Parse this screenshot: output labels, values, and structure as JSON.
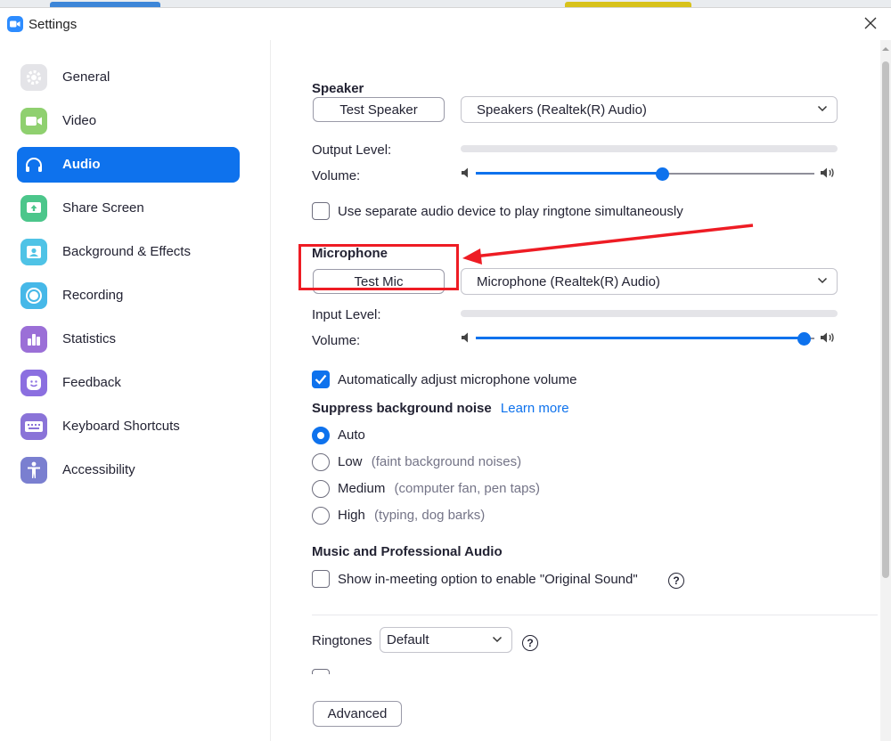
{
  "window": {
    "title": "Settings"
  },
  "sidebar": {
    "items": [
      {
        "label": "General",
        "icon": "gear-icon",
        "color": "#e4e4e8"
      },
      {
        "label": "Video",
        "icon": "video-camera-icon",
        "color": "#8fd06f"
      },
      {
        "label": "Audio",
        "icon": "headphones-icon",
        "color": "#0e72ed"
      },
      {
        "label": "Share Screen",
        "icon": "share-screen-icon",
        "color": "#4cc68b"
      },
      {
        "label": "Background & Effects",
        "icon": "person-portrait-icon",
        "color": "#4fc3e6"
      },
      {
        "label": "Recording",
        "icon": "record-icon",
        "color": "#46b8e8"
      },
      {
        "label": "Statistics",
        "icon": "bar-chart-icon",
        "color": "#9b6fd7"
      },
      {
        "label": "Feedback",
        "icon": "smiley-icon",
        "color": "#8b6fe0"
      },
      {
        "label": "Keyboard Shortcuts",
        "icon": "keyboard-icon",
        "color": "#8a73d8"
      },
      {
        "label": "Accessibility",
        "icon": "accessibility-icon",
        "color": "#7a7fd0"
      }
    ],
    "active_index": 2
  },
  "speaker": {
    "title": "Speaker",
    "test_button": "Test Speaker",
    "device": "Speakers (Realtek(R) Audio)",
    "output_level_label": "Output Level:",
    "volume_label": "Volume:",
    "volume_fraction": 0.55,
    "separate_device_label": "Use separate audio device to play ringtone simultaneously",
    "separate_device_checked": false
  },
  "microphone": {
    "title": "Microphone",
    "test_button": "Test Mic",
    "device": "Microphone (Realtek(R) Audio)",
    "input_level_label": "Input Level:",
    "volume_label": "Volume:",
    "volume_fraction": 0.97,
    "auto_adjust_label": "Automatically adjust microphone volume",
    "auto_adjust_checked": true
  },
  "noise": {
    "title": "Suppress background noise",
    "learn_more": "Learn more",
    "options": [
      {
        "label": "Auto",
        "hint": "",
        "checked": true
      },
      {
        "label": "Low",
        "hint": "(faint background noises)",
        "checked": false
      },
      {
        "label": "Medium",
        "hint": "(computer fan, pen taps)",
        "checked": false
      },
      {
        "label": "High",
        "hint": "(typing, dog barks)",
        "checked": false
      }
    ]
  },
  "music": {
    "title": "Music and Professional Audio",
    "original_sound_label": "Show in-meeting option to enable \"Original Sound\"",
    "original_sound_checked": false,
    "help": "?"
  },
  "ringtones": {
    "label": "Ringtones",
    "value": "Default",
    "help": "?"
  },
  "advanced_button": "Advanced",
  "colors": {
    "accent": "#0e72ed",
    "annotation": "#ee1c24"
  }
}
